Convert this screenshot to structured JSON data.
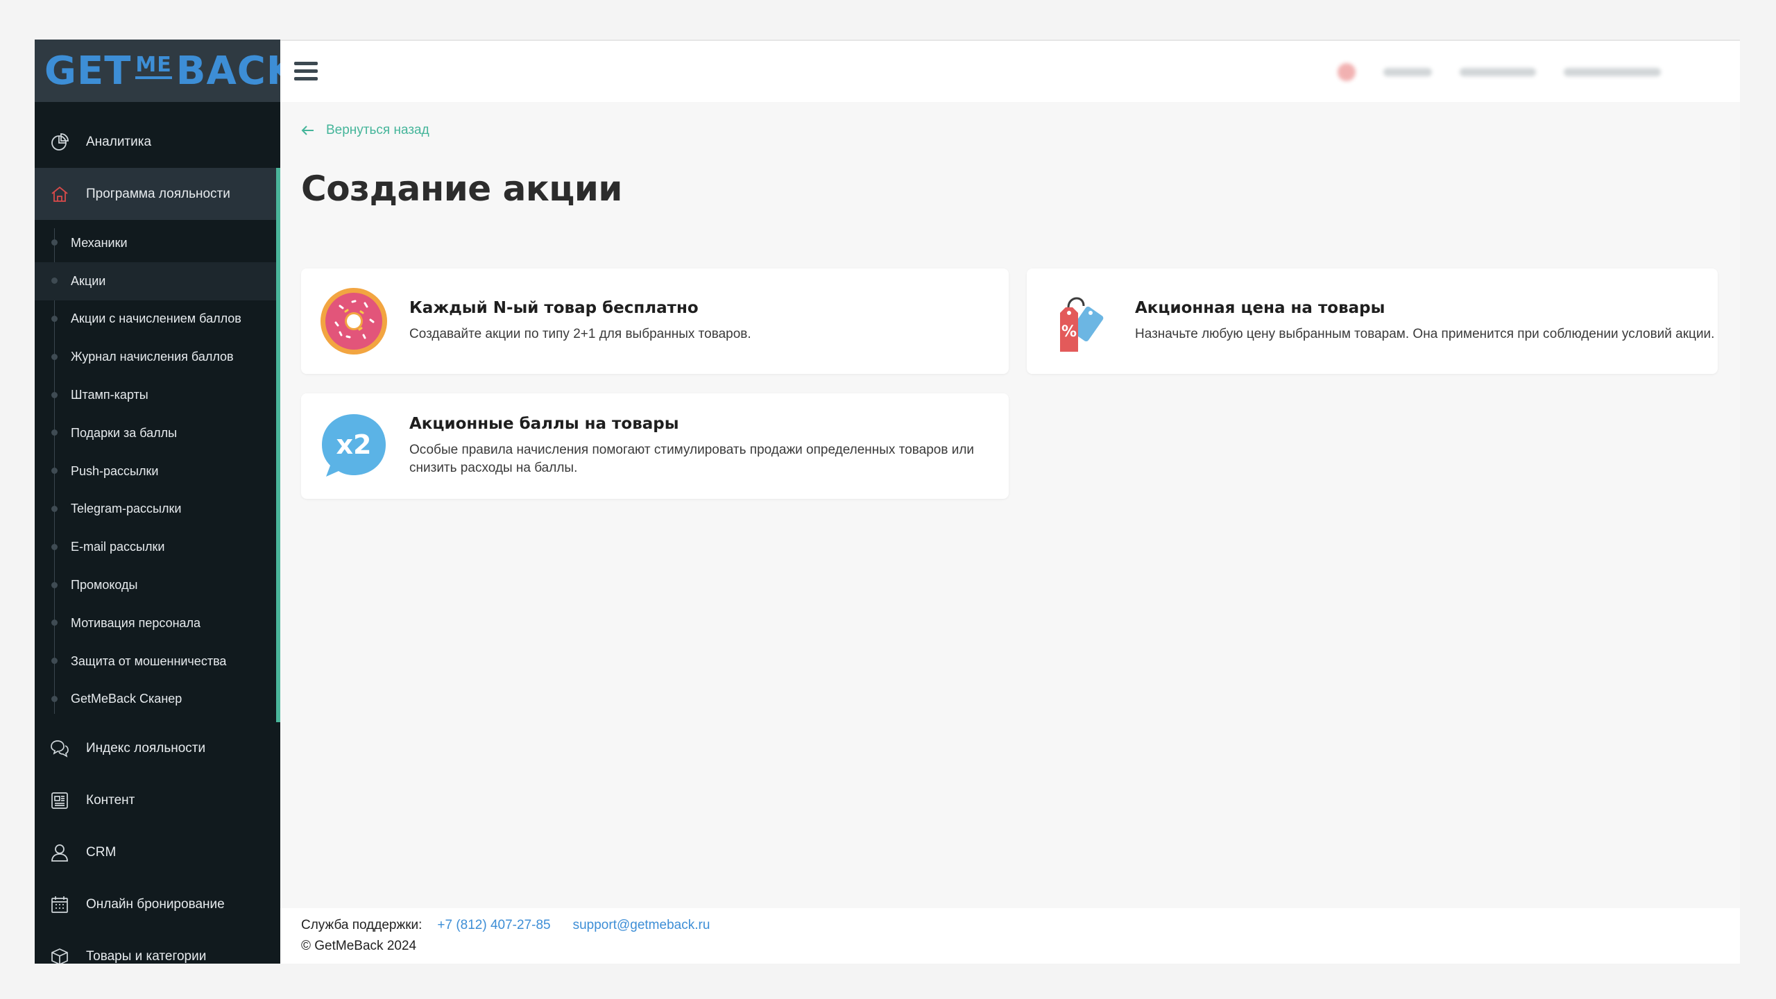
{
  "logo": {
    "part1": "GET",
    "part2": "ME",
    "part3": "BACK"
  },
  "sidebar": {
    "top_items": [
      {
        "label": "Аналитика",
        "icon": "pie-chart-icon"
      },
      {
        "label": "Программа лояльности",
        "icon": "home-icon"
      }
    ],
    "sub_items": [
      "Механики",
      "Акции",
      "Акции с начислением баллов",
      "Журнал начисления баллов",
      "Штамп-карты",
      "Подарки за баллы",
      "Push-рассылки",
      "Telegram-рассылки",
      "E-mail рассылки",
      "Промокоды",
      "Мотивация персонала",
      "Защита от мошенничества",
      "GetMeBack Сканер"
    ],
    "bottom_items": [
      {
        "label": "Индекс лояльности",
        "icon": "chat-bubbles-icon"
      },
      {
        "label": "Контент",
        "icon": "newspaper-icon"
      },
      {
        "label": "CRM",
        "icon": "user-icon"
      },
      {
        "label": "Онлайн бронирование",
        "icon": "calendar-icon"
      },
      {
        "label": "Товары и категории",
        "icon": "box-icon"
      }
    ]
  },
  "main": {
    "back_label": "Вернуться назад",
    "title": "Создание акции",
    "cards": [
      {
        "title": "Каждый N-ый товар бесплатно",
        "description": "Создавайте акции по типу 2+1 для выбранных товаров.",
        "icon": "donut-icon"
      },
      {
        "title": "Акционная цена на товары",
        "description": "Назначьте любую цену выбранным товарам. Она применится при соблюдении условий акции.",
        "icon": "price-tag-icon"
      },
      {
        "title": "Акционные баллы на товары",
        "description": "Особые правила начисления помогают стимулировать продажи определенных товаров или снизить расходы на баллы.",
        "icon": "x2-badge-icon",
        "icon_text": "x2"
      }
    ]
  },
  "footer": {
    "support_label": "Служба поддержки:",
    "phone": "+7 (812) 407-27-85",
    "email": "support@getmeback.ru",
    "copyright": "© GetMeBack 2024"
  },
  "colors": {
    "sidebar_bg": "#111a1e",
    "accent_green": "#4ab59a",
    "link_blue": "#3d8ed6",
    "logo_blue": "#3d8ed6"
  }
}
